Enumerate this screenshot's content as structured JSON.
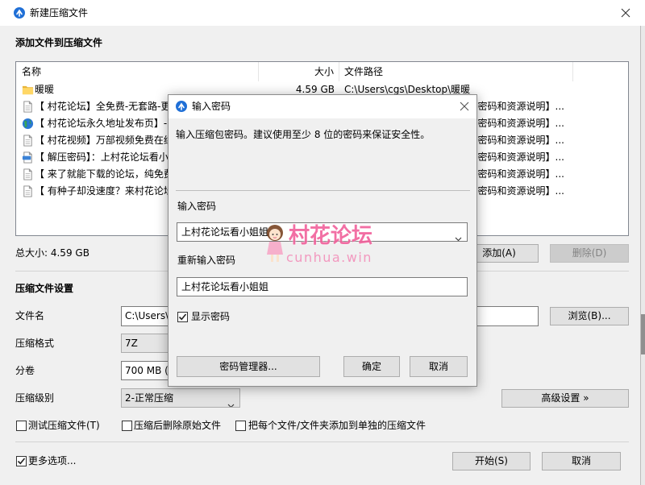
{
  "window": {
    "title": "新建压缩文件",
    "icon": "bandizip-app-icon",
    "close_icon": "close-icon"
  },
  "files": {
    "heading": "添加文件到压缩文件",
    "columns": {
      "name": "名称",
      "size": "大小",
      "path": "文件路径"
    },
    "rows": [
      {
        "icon": "folder-icon",
        "name": "暖暖",
        "size": "4.59 GB",
        "path": "C:\\Users\\cgs\\Desktop\\暖暖"
      },
      {
        "icon": "document-icon",
        "name": "【 村花论坛】全免费-无套路-更",
        "path": "密码和资源说明】..."
      },
      {
        "icon": "globe-icon",
        "name": "【 村花论坛永久地址发布页】-",
        "path": "密码和资源说明】..."
      },
      {
        "icon": "document-icon",
        "name": "【 村花视频】万部视频免费在线",
        "path": "密码和资源说明】..."
      },
      {
        "icon": "jpg-image-icon",
        "name": "【 解压密码】：上村花论坛看小",
        "path": "密码和资源说明】..."
      },
      {
        "icon": "document-icon",
        "name": "【 来了就能下载的论坛，纯免费",
        "path": "密码和资源说明】..."
      },
      {
        "icon": "document-icon",
        "name": "【 有种子却没速度？来村花论坛",
        "path": "密码和资源说明】..."
      }
    ],
    "total_size": "总大小: 4.59 GB",
    "add_button": "添加(A)",
    "delete_button": "删除(D)"
  },
  "settings": {
    "heading": "压缩文件设置",
    "filename": {
      "label": "文件名",
      "value": "C:\\Users\\"
    },
    "browse_button": "浏览(B)...",
    "format": {
      "label": "压缩格式",
      "value": "7Z"
    },
    "split": {
      "label": "分卷",
      "value": "700 MB ("
    },
    "level": {
      "label": "压缩级别",
      "value": "2-正常压缩"
    },
    "advanced_button": "高级设置 »",
    "options": [
      {
        "label": "测试压缩文件(T)",
        "checked": false
      },
      {
        "label": "压缩后删除原始文件",
        "checked": false
      },
      {
        "label": "把每个文件/文件夹添加到单独的压缩文件",
        "checked": false
      }
    ],
    "more_options": {
      "label": "更多选项...",
      "checked": true
    }
  },
  "footer": {
    "start_button": "开始(S)",
    "cancel_button": "取消"
  },
  "password_dialog": {
    "title": "输入密码",
    "description": "输入压缩包密码。建议使用至少 8 位的密码来保证安全性。",
    "password_label": "输入密码",
    "password_value": "上村花论坛看小姐姐",
    "confirm_label": "重新输入密码",
    "confirm_value": "上村花论坛看小姐姐",
    "show_password": {
      "label": "显示密码",
      "checked": true
    },
    "manager_button": "密码管理器...",
    "ok_button": "确定",
    "cancel_button": "取消"
  },
  "watermark": {
    "title": "村花论坛",
    "url": "cunhua.win"
  },
  "colors": {
    "window_bg": "#f0f0f0",
    "app_icon_blue": "#1f6fd6",
    "watermark_pink": "#f1609b",
    "disabled_text": "#838383"
  }
}
